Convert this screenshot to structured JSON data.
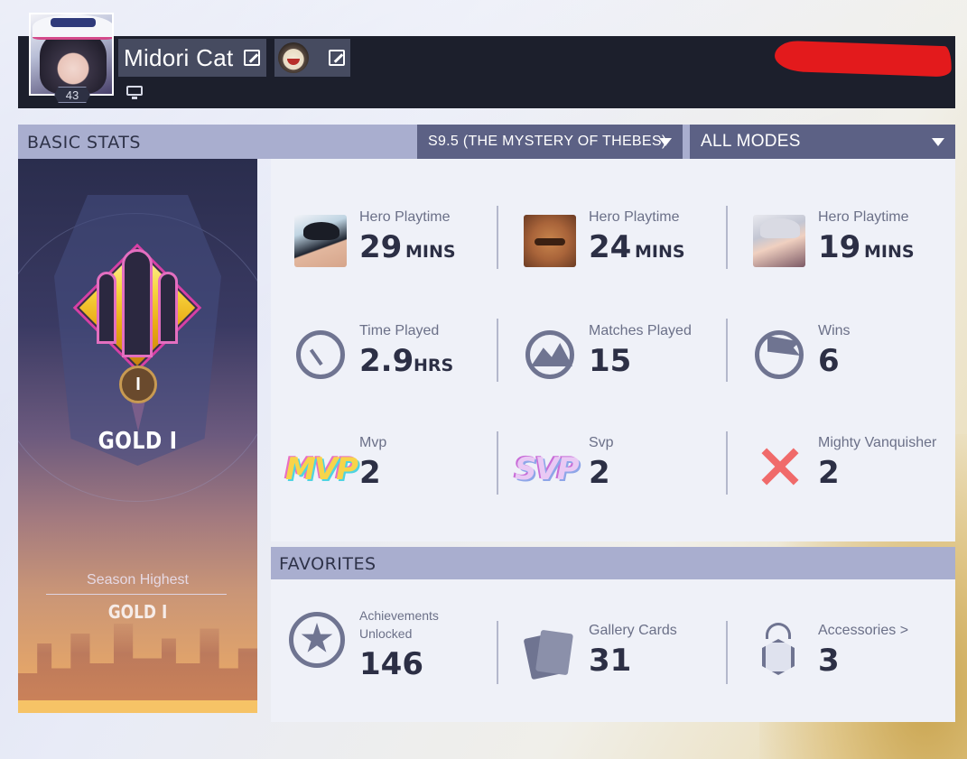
{
  "profile": {
    "name": "Midori Cat",
    "level": "43",
    "platform_icon": "monitor-icon"
  },
  "basic_stats": {
    "title": "BASIC STATS",
    "season_select": "S9.5 (THE MYSTERY OF THEBES)",
    "mode_select": "ALL MODES"
  },
  "rank": {
    "tier_numeral": "I",
    "current": "GOLD I",
    "season_highest_label": "Season Highest",
    "season_highest": "GOLD I"
  },
  "stats": {
    "hero1": {
      "label": "Hero Playtime",
      "value": "29",
      "unit": "MINS"
    },
    "hero2": {
      "label": "Hero Playtime",
      "value": "24",
      "unit": "MINS"
    },
    "hero3": {
      "label": "Hero Playtime",
      "value": "19",
      "unit": "MINS"
    },
    "time_played": {
      "label": "Time Played",
      "value": "2.9",
      "unit": "HRS"
    },
    "matches_played": {
      "label": "Matches Played",
      "value": "15"
    },
    "wins": {
      "label": "Wins",
      "value": "6"
    },
    "mvp": {
      "label": "Mvp",
      "value": "2",
      "logo": "MVP"
    },
    "svp": {
      "label": "Svp",
      "value": "2",
      "logo": "SVP"
    },
    "mighty_vanquisher": {
      "label": "Mighty Vanquisher",
      "value": "2"
    }
  },
  "favorites": {
    "title": "FAVORITES",
    "achievements": {
      "label": "Achievements Unlocked",
      "value": "146"
    },
    "gallery_cards": {
      "label": "Gallery Cards",
      "value": "31"
    },
    "accessories": {
      "label": "Accessories >",
      "value": "3"
    }
  },
  "colors": {
    "header_bg": "#1c1f2c",
    "bar_bg": "#a9aecf",
    "dropdown_bg": "#5c6185",
    "panel_bg": "#eff1f8",
    "value_text": "#2c2f45",
    "icon_gray": "#6f7491",
    "redaction": "#e31a1c"
  }
}
